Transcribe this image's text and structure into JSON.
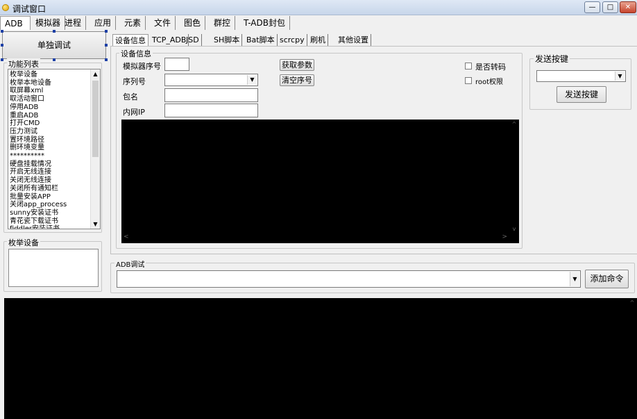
{
  "window": {
    "title": "调试窗口",
    "min": "—",
    "max": "□",
    "close": "✕"
  },
  "top_tabs": [
    "ADB",
    "模拟器",
    "进程",
    "应用",
    "元素",
    "文件",
    "图色",
    "群控",
    "T-ADB封包"
  ],
  "left": {
    "single_debug_button": "单独调试",
    "function_list_title": "功能列表",
    "function_items": [
      "枚举设备",
      "枚举本地设备",
      "取屏幕xml",
      "取活动窗口",
      "停用ADB",
      "重启ADB",
      "打开CMD",
      "压力测试",
      "置环境路径",
      "删环境变量",
      "**********",
      "硬盘挂载情况",
      "开启无线连接",
      "关闭无线连接",
      "关闭所有通知栏",
      "批量安装APP",
      "关闭app_process",
      "sunny安装证书",
      "青花瓷下载证书",
      "fiddler安装证书"
    ],
    "enum_devices_title": "枚举设备"
  },
  "sub_tabs": [
    "设备信息",
    "TCP_ADB",
    "JSD",
    "SH脚本",
    "Bat脚本",
    "scrcpy",
    "刷机",
    "其他设置"
  ],
  "device_info": {
    "group_title": "设备信息",
    "emulator_index_label": "模拟器序号",
    "emulator_index_value": "",
    "serial_label": "序列号",
    "serial_value": "",
    "package_label": "包名",
    "package_value": "",
    "lan_ip_label": "内网IP",
    "lan_ip_value": "",
    "get_params_button": "获取参数",
    "clear_serial_button": "清空序号",
    "transcode_label": "是否转码",
    "root_label": "root权限"
  },
  "send_key": {
    "group_title": "发送按键",
    "selected": "",
    "send_button": "发送按键"
  },
  "adb_debug": {
    "group_title": "ADB调试",
    "command_value": "",
    "add_command_button": "添加命令"
  },
  "colors": {
    "console_bg": "#000000",
    "window_bg": "#f0f0f0",
    "handle": "#1d3fa6"
  },
  "icons": [
    "app-icon",
    "chevron-down-icon",
    "chevron-up-icon",
    "chevron-left-icon",
    "chevron-right-icon"
  ]
}
